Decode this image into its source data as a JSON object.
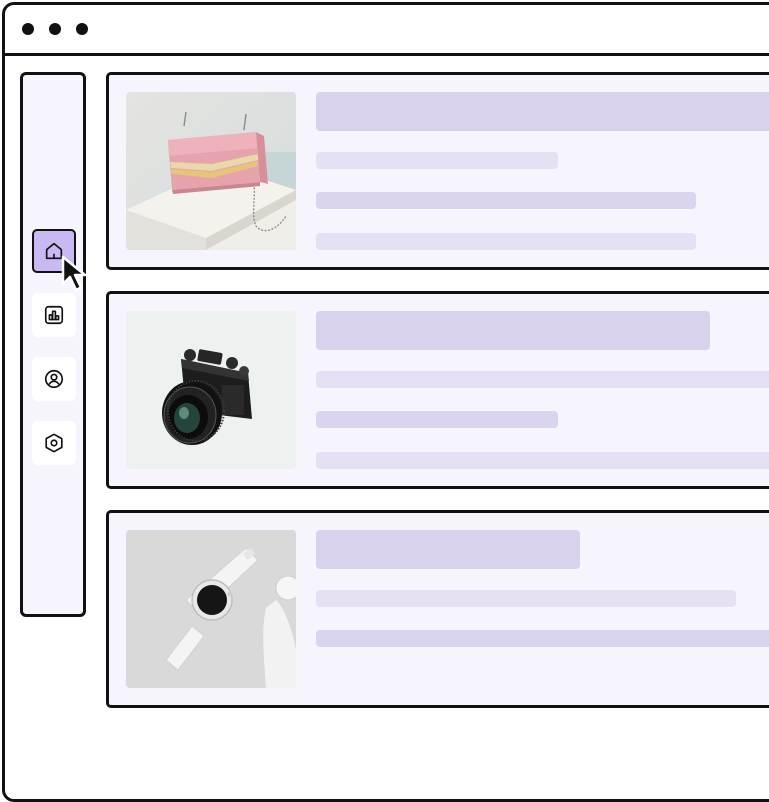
{
  "window": {
    "controls": [
      "dot-1",
      "dot-2",
      "dot-3"
    ]
  },
  "sidebar": {
    "items": [
      {
        "id": "home",
        "icon": "home-icon",
        "active": true
      },
      {
        "id": "analytics",
        "icon": "bar-chart-icon",
        "active": false
      },
      {
        "id": "profile",
        "icon": "user-circle-icon",
        "active": false
      },
      {
        "id": "settings",
        "icon": "hexagon-settings-icon",
        "active": false
      }
    ]
  },
  "products": [
    {
      "image": "pink-handbag-photo",
      "placeholder_lines": 4
    },
    {
      "image": "black-camera-photo",
      "placeholder_lines": 4
    },
    {
      "image": "white-smartwatch-photo",
      "placeholder_lines": 3
    }
  ],
  "colors": {
    "accent": "#c9b8f2",
    "panel": "#f6f4fd",
    "skeleton_dark": "#d9d2ec",
    "skeleton_light": "#e6e0f5",
    "border": "#111111"
  }
}
